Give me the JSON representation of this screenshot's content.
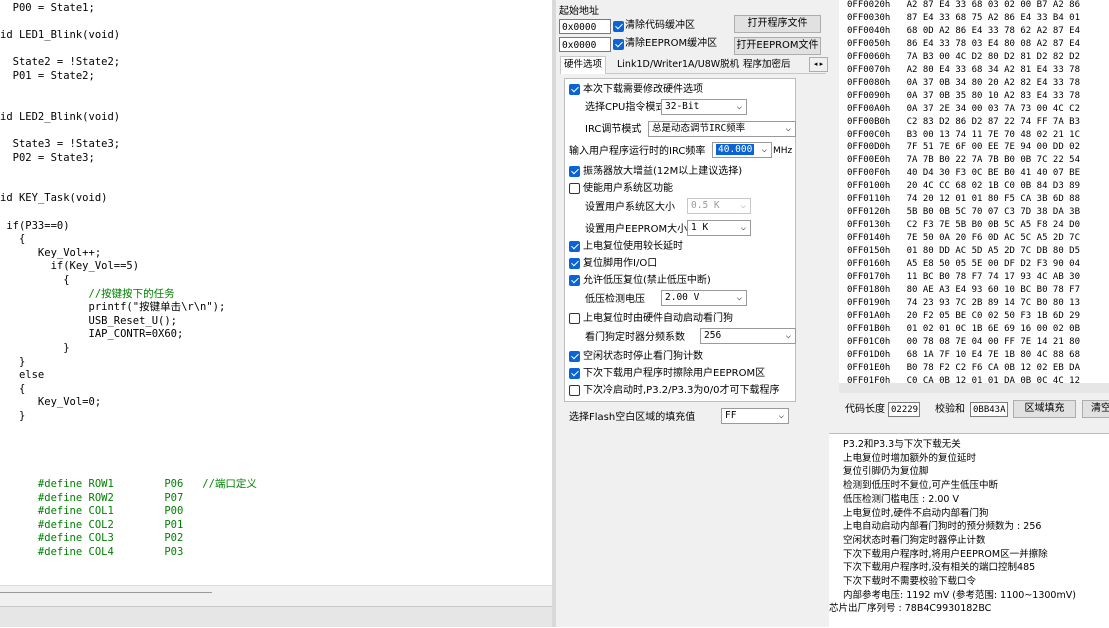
{
  "editor": {
    "lines": [
      {
        "text": "  P00 = State1;",
        "kind": "code"
      },
      {
        "text": "",
        "kind": "code"
      },
      {
        "text": "id LED1_Blink(void)",
        "kind": "code"
      },
      {
        "text": "",
        "kind": "code"
      },
      {
        "text": "  State2 = !State2;",
        "kind": "code"
      },
      {
        "text": "  P01 = State2;",
        "kind": "code"
      },
      {
        "text": "",
        "kind": "code"
      },
      {
        "text": "",
        "kind": "code"
      },
      {
        "text": "id LED2_Blink(void)",
        "kind": "code"
      },
      {
        "text": "",
        "kind": "code"
      },
      {
        "text": "  State3 = !State3;",
        "kind": "code"
      },
      {
        "text": "  P02 = State3;",
        "kind": "code"
      },
      {
        "text": "",
        "kind": "code"
      },
      {
        "text": "",
        "kind": "code"
      },
      {
        "text": "id KEY_Task(void)",
        "kind": "code"
      },
      {
        "text": "",
        "kind": "code"
      },
      {
        "text": " if(P33==0)",
        "kind": "code"
      },
      {
        "text": "   {",
        "kind": "code"
      },
      {
        "text": "      Key_Vol++;",
        "kind": "code"
      },
      {
        "text": "        if(Key_Vol==5)",
        "kind": "code"
      },
      {
        "text": "          {",
        "kind": "code"
      },
      {
        "text": "              //按键按下的任务",
        "kind": "comment"
      },
      {
        "text": "              printf(\"按键单击\\r\\n\");",
        "kind": "code"
      },
      {
        "text": "              USB_Reset_U();",
        "kind": "code"
      },
      {
        "text": "              IAP_CONTR=0X60;",
        "kind": "code"
      },
      {
        "text": "          }",
        "kind": "code"
      },
      {
        "text": "   }",
        "kind": "code"
      },
      {
        "text": "   else",
        "kind": "code"
      },
      {
        "text": "   {",
        "kind": "code"
      },
      {
        "text": "      Key_Vol=0;",
        "kind": "code"
      },
      {
        "text": "   }",
        "kind": "code"
      },
      {
        "text": "",
        "kind": "code"
      },
      {
        "text": "",
        "kind": "code"
      },
      {
        "text": "",
        "kind": "code"
      },
      {
        "text": "",
        "kind": "code"
      },
      {
        "text": "      #define ROW1        P06   //端口定义",
        "kind": "define"
      },
      {
        "text": "      #define ROW2        P07",
        "kind": "define"
      },
      {
        "text": "      #define COL1        P00",
        "kind": "define"
      },
      {
        "text": "      #define COL2        P01",
        "kind": "define"
      },
      {
        "text": "      #define COL3        P02",
        "kind": "define"
      },
      {
        "text": "      #define COL4        P03",
        "kind": "define"
      }
    ]
  },
  "tool": {
    "start_addr_label": "起始地址",
    "addr1": "0x0000",
    "clear_code_label": "清除代码缓冲区",
    "addr2": "0x0000",
    "clear_eeprom_label": "清除EEPROM缓冲区",
    "open_program_btn": "打开程序文件",
    "open_eeprom_btn": "打开EEPROM文件",
    "tabs": [
      "硬件选项",
      "Link1D/Writer1A/U8W脱机",
      "程序加密后"
    ],
    "tab_scroll": "◂ ▸",
    "opt_modify_hw": "本次下载需要修改硬件选项",
    "cpu_mode_label": "选择CPU指令模式",
    "cpu_mode_value": "32-Bit",
    "irc_mode_label": "IRC调节模式",
    "irc_mode_value": "总是动态调节IRC频率",
    "irc_freq_label": "输入用户程序运行时的IRC频率",
    "irc_freq_value": "40.000",
    "irc_freq_unit": "MHz",
    "opt_osc_gain": "振荡器放大增益(12M以上建议选择)",
    "opt_user_sys": "使能用户系统区功能",
    "user_sys_size_label": "设置用户系统区大小",
    "user_sys_size_value": "0.5 K",
    "eeprom_size_label": "设置用户EEPROM大小",
    "eeprom_size_value": "1  K",
    "opt_long_reset": "上电复位使用较长延时",
    "opt_reset_io": "复位脚用作I/O口",
    "opt_lvd_reset": "允许低压复位(禁止低压中断)",
    "lvd_label": "低压检测电压",
    "lvd_value": "2.00 V",
    "opt_wdt_hw": "上电复位时由硬件自动启动看门狗",
    "wdt_div_label": "看门狗定时器分频系数",
    "wdt_div_value": "256",
    "opt_idle_wdt": "空闲状态时停止看门狗计数",
    "opt_erase_eeprom": "下次下载用户程序时擦除用户EEPROM区",
    "opt_cold_p32": "下次冷启动时,P3.2/P3.3为0/0才可下载程序",
    "fill_label": "选择Flash空白区域的填充值",
    "fill_value": "FF"
  },
  "hex": {
    "rows": [
      "0FF0020h   A2 87 E4 33 68 03 02 00 B7 A2 86",
      "0FF0030h   87 E4 33 68 75 A2 86 E4 33 B4 01",
      "0FF0040h   68 0D A2 86 E4 33 78 62 A2 87 E4",
      "0FF0050h   86 E4 33 78 03 E4 80 08 A2 87 E4",
      "0FF0060h   7A B3 00 4C D2 80 D2 81 D2 82 D2",
      "0FF0070h   A2 80 E4 33 68 34 A2 81 E4 33 78",
      "0FF0080h   0A 37 0B 34 80 20 A2 82 E4 33 78",
      "0FF0090h   0A 37 0B 35 80 10 A2 83 E4 33 78",
      "0FF00A0h   0A 37 2E 34 00 03 7A 73 00 4C C2",
      "0FF00B0h   C2 83 D2 86 D2 87 22 74 FF 7A B3",
      "0FF00C0h   B3 00 13 74 11 7E 70 48 02 21 1C",
      "0FF00D0h   7F 51 7E 6F 00 EE 7E 94 00 DD 02",
      "0FF00E0h   7A 7B B0 22 7A 7B B0 0B 7C 22 54",
      "0FF00F0h   40 D4 30 F3 0C BE B0 41 40 07 BE",
      "0FF0100h   20 4C CC 68 02 1B C0 0B 84 D3 89",
      "0FF0110h   74 20 12 01 01 80 F5 CA 3B 6D 88",
      "0FF0120h   5B B0 0B 5C 70 07 C3 7D 38 DA 3B",
      "0FF0130h   C2 F3 7E 5B B0 0B 5C A5 F8 24 D0",
      "0FF0140h   7E 50 0A 20 F6 0D AC 5C A5 2D 7C",
      "0FF0150h   01 80 DD AC 5D A5 2D 7C DB 80 D5",
      "0FF0160h   A5 E8 50 05 5E 00 DF D2 F3 90 04",
      "0FF0170h   11 BC B0 78 F7 74 17 93 4C AB 30",
      "0FF0180h   80 AE A3 E4 93 60 10 BC B0 78 F7",
      "0FF0190h   74 23 93 7C 2B 89 14 7C B0 80 13",
      "0FF01A0h   20 F2 05 BE C0 02 50 F3 1B 6D 29",
      "0FF01B0h   01 02 01 0C 1B 6E 69 16 00 02 0B",
      "0FF01C0h   00 78 08 7E 04 00 FF 7E 14 21 80",
      "0FF01D0h   68 1A 7F 10 E4 7E 1B 80 4C 88 68",
      "0FF01E0h   B0 78 F2 C2 F6 CA 0B 12 02 EB DA",
      "0FF01F0h   C0 CA 0B 12 01 01 DA 0B 0C 4C 12"
    ],
    "code_len_label": "代码长度",
    "code_len_value": "02229",
    "checksum_label": "校验和",
    "checksum_value": "0BB43A",
    "fill_region_btn": "区域填充",
    "clear_btn": "清空"
  },
  "status": {
    "lines": [
      "  P3.2和P3.3与下次下载无关",
      "  上电复位时增加额外的复位延时",
      "  复位引脚仍为复位脚",
      "  检测到低压时不复位,可产生低压中断",
      "  低压检测门槛电压 : 2.00 V",
      "  上电复位时,硬件不启动内部看门狗",
      "  上电自动启动内部看门狗时的预分频数为 : 256",
      "  空闲状态时看门狗定时器停止计数",
      "  下次下载用户程序时,将用户EEPROM区一并擦除",
      "  下次下载用户程序时,没有相关的端口控制485",
      "  下次下载时不需要校验下载口令",
      "  内部参考电压: 1192 mV (参考范围: 1100~1300mV)",
      "芯片出厂序列号 : 78B4C9930182BC"
    ]
  }
}
